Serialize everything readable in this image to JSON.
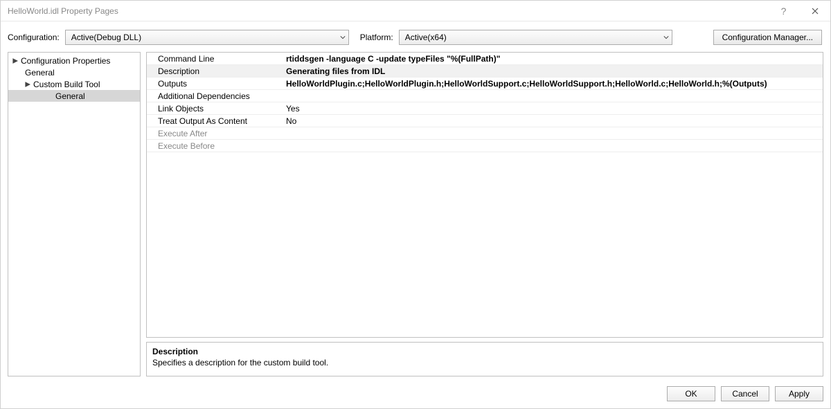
{
  "window": {
    "title": "HelloWorld.idl Property Pages"
  },
  "config_bar": {
    "configuration_label": "Configuration:",
    "configuration_value": "Active(Debug DLL)",
    "platform_label": "Platform:",
    "platform_value": "Active(x64)",
    "manager_label": "Configuration Manager..."
  },
  "tree": {
    "root": "Configuration Properties",
    "general1": "General",
    "custom_build": "Custom Build Tool",
    "general2": "General"
  },
  "properties": [
    {
      "name": "Command Line",
      "value": "rtiddsgen -language C -update typeFiles \"%(FullPath)\"",
      "bold": true
    },
    {
      "name": "Description",
      "value": "Generating files from IDL",
      "bold": true,
      "selected": true
    },
    {
      "name": "Outputs",
      "value": "HelloWorldPlugin.c;HelloWorldPlugin.h;HelloWorldSupport.c;HelloWorldSupport.h;HelloWorld.c;HelloWorld.h;%(Outputs)",
      "bold": true
    },
    {
      "name": "Additional Dependencies",
      "value": ""
    },
    {
      "name": "Link Objects",
      "value": "Yes"
    },
    {
      "name": "Treat Output As Content",
      "value": "No"
    },
    {
      "name": "Execute After",
      "value": "",
      "disabled": true
    },
    {
      "name": "Execute Before",
      "value": "",
      "disabled": true
    }
  ],
  "help": {
    "title": "Description",
    "body": "Specifies a description for the custom build tool."
  },
  "buttons": {
    "ok": "OK",
    "cancel": "Cancel",
    "apply": "Apply"
  }
}
